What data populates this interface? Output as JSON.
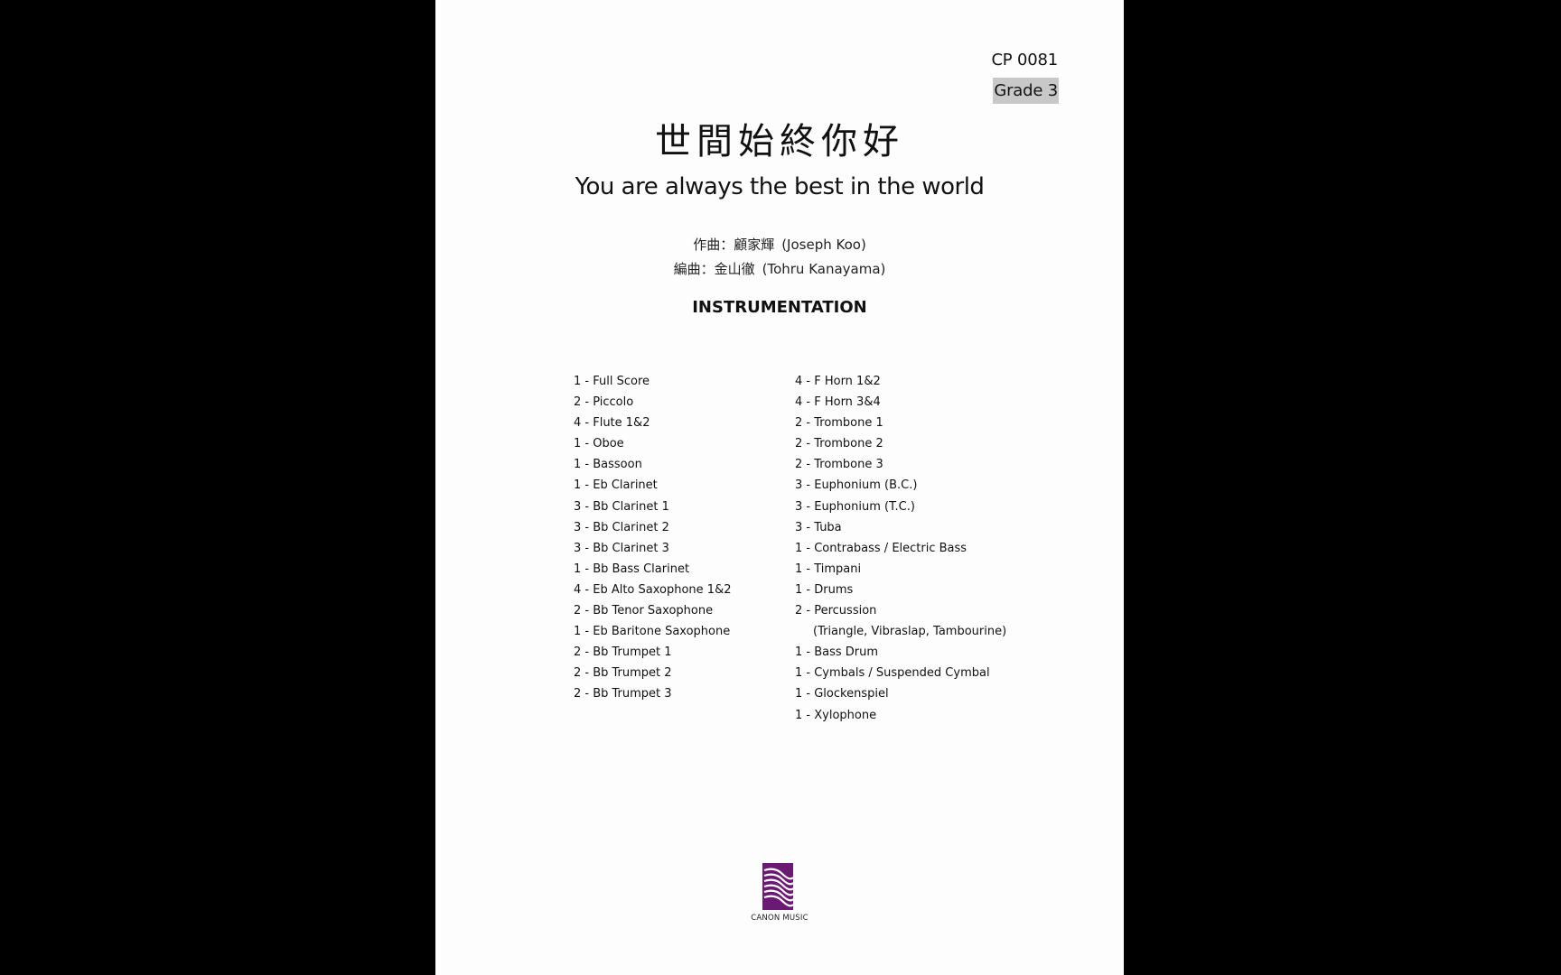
{
  "header": {
    "catalog_number": "CP 0081",
    "grade": "Grade 3"
  },
  "title": {
    "chinese": "世間始終你好",
    "english": "You are always the best in the world"
  },
  "credits": {
    "composer_label": "作曲：顧家輝",
    "composer_name": "(Joseph Koo)",
    "arranger_label": "編曲：金山徹",
    "arranger_name": "(Tohru Kanayama)"
  },
  "instrumentation": {
    "heading": "INSTRUMENTATION",
    "left_column": [
      "1 - Full Score",
      "2 - Piccolo",
      "4 - Flute 1&2",
      "1 - Oboe",
      "1 - Bassoon",
      "1 - Eb Clarinet",
      "3 - Bb Clarinet 1",
      "3 - Bb Clarinet 2",
      "3 - Bb Clarinet 3",
      "1 - Bb Bass Clarinet",
      "4 - Eb Alto Saxophone 1&2",
      "2 - Bb Tenor Saxophone",
      "1 - Eb Baritone Saxophone",
      "2 - Bb Trumpet 1",
      "2 - Bb Trumpet 2",
      "2 - Bb Trumpet 3"
    ],
    "right_column": [
      "4 - F Horn 1&2",
      "4 - F Horn 3&4",
      "2 - Trombone 1",
      "2 - Trombone 2",
      "2 - Trombone 3",
      "3 - Euphonium (B.C.)",
      "3 - Euphonium (T.C.)",
      "3 - Tuba",
      "1 - Contrabass / Electric Bass",
      "1 - Timpani",
      "1 - Drums",
      "2 - Percussion",
      "(Triangle, Vibraslap, Tambourine)",
      "1 - Bass Drum",
      "1 - Cymbals / Suspended Cymbal",
      "1 - Glockenspiel",
      "1 - Xylophone"
    ]
  },
  "publisher": {
    "logo_icon": "canon-music-wave-logo",
    "name": "CANON MUSIC",
    "brand_color": "#6b1a74"
  }
}
